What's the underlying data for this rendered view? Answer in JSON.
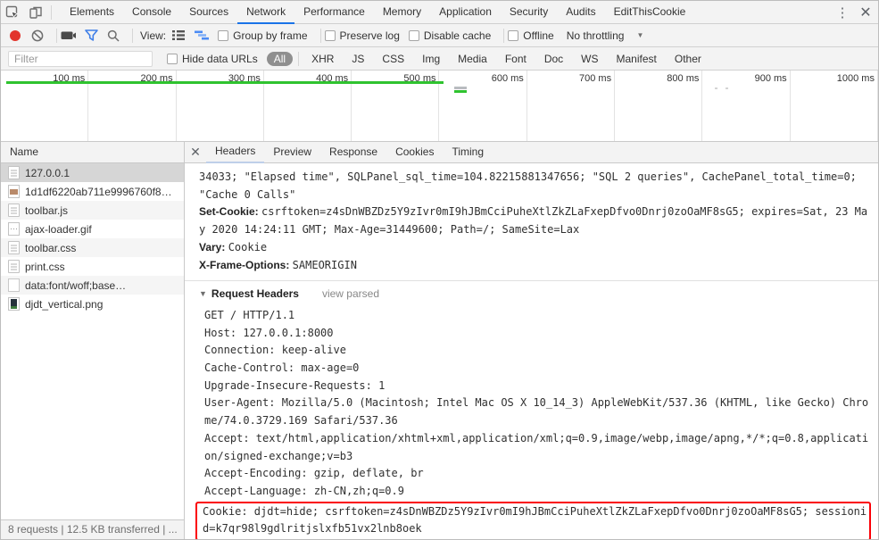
{
  "tabbar": {
    "tabs": [
      "Elements",
      "Console",
      "Sources",
      "Network",
      "Performance",
      "Memory",
      "Application",
      "Security",
      "Audits",
      "EditThisCookie"
    ],
    "active_tab": "Network",
    "accent_color": "#1a73e8"
  },
  "toolbar": {
    "view_label": "View:",
    "checkboxes": [
      "Group by frame",
      "Preserve log",
      "Disable cache",
      "Offline"
    ],
    "throttling_label": "No throttling",
    "record_color": "#e2342c"
  },
  "filter_bar": {
    "placeholder": "Filter",
    "hide_data_urls_label": "Hide data URLs",
    "types": [
      "All",
      "XHR",
      "JS",
      "CSS",
      "Img",
      "Media",
      "Font",
      "Doc",
      "WS",
      "Manifest",
      "Other"
    ],
    "active_type": "All"
  },
  "overview": {
    "ticks": [
      "100 ms",
      "200 ms",
      "300 ms",
      "400 ms",
      "500 ms",
      "600 ms",
      "700 ms",
      "800 ms",
      "900 ms",
      "1000 ms"
    ],
    "load_line_color": "#2fc32f"
  },
  "requests": {
    "header": "Name",
    "rows": [
      {
        "name": "127.0.0.1",
        "icon": "document",
        "selected": true
      },
      {
        "name": "1d1df6220ab711e9996760f8…",
        "icon": "image",
        "selected": false
      },
      {
        "name": "toolbar.js",
        "icon": "document",
        "selected": false
      },
      {
        "name": "ajax-loader.gif",
        "icon": "gif",
        "selected": false
      },
      {
        "name": "toolbar.css",
        "icon": "document",
        "selected": false
      },
      {
        "name": "print.css",
        "icon": "document",
        "selected": false
      },
      {
        "name": "data:font/woff;base…",
        "icon": "blank",
        "selected": false
      },
      {
        "name": "djdt_vertical.png",
        "icon": "image-dark",
        "selected": false
      }
    ]
  },
  "detail": {
    "tabs": [
      "Headers",
      "Preview",
      "Response",
      "Cookies",
      "Timing"
    ],
    "active_tab": "Headers"
  },
  "headers_panel": {
    "response_fragment": "34033; \"Elapsed time\", SQLPanel_sql_time=104.82215881347656; \"SQL 2 queries\", CachePanel_total_time=0; \"Cache 0 Calls\"",
    "response_headers": [
      {
        "name": "Set-Cookie:",
        "value": "csrftoken=z4sDnWBZDz5Y9zIvr0mI9hJBmCciPuheXtlZkZLaFxepDfvo0Dnrj0zoOaMF8sG5; expires=Sat, 23 May 2020 14:24:11 GMT; Max-Age=31449600; Path=/; SameSite=Lax"
      },
      {
        "name": "Vary:",
        "value": "Cookie"
      },
      {
        "name": "X-Frame-Options:",
        "value": "SAMEORIGIN"
      }
    ],
    "request_section": {
      "title": "Request Headers",
      "view_parsed_label": "view parsed"
    },
    "request_raw_lines": [
      "GET / HTTP/1.1",
      "Host: 127.0.0.1:8000",
      "Connection: keep-alive",
      "Cache-Control: max-age=0",
      "Upgrade-Insecure-Requests: 1",
      "User-Agent: Mozilla/5.0 (Macintosh; Intel Mac OS X 10_14_3) AppleWebKit/537.36 (KHTML, like Gecko) Chrome/74.0.3729.169 Safari/537.36",
      "Accept: text/html,application/xhtml+xml,application/xml;q=0.9,image/webp,image/apng,*/*;q=0.8,application/signed-exchange;v=b3",
      "Accept-Encoding: gzip, deflate, br",
      "Accept-Language: zh-CN,zh;q=0.9",
      "Cookie: djdt=hide; csrftoken=z4sDnWBZDz5Y9zIvr0mI9hJBmCciPuheXtlZkZLaFxepDfvo0Dnrj0zoOaMF8sG5; sessionid=k7qr98l9gdlritjslxfb51vx2lnb8oek"
    ],
    "highlighted_line_index": 9,
    "highlight_color": "#fb0007"
  },
  "status_bar": {
    "text": "8 requests | 12.5 KB transferred | ..."
  }
}
